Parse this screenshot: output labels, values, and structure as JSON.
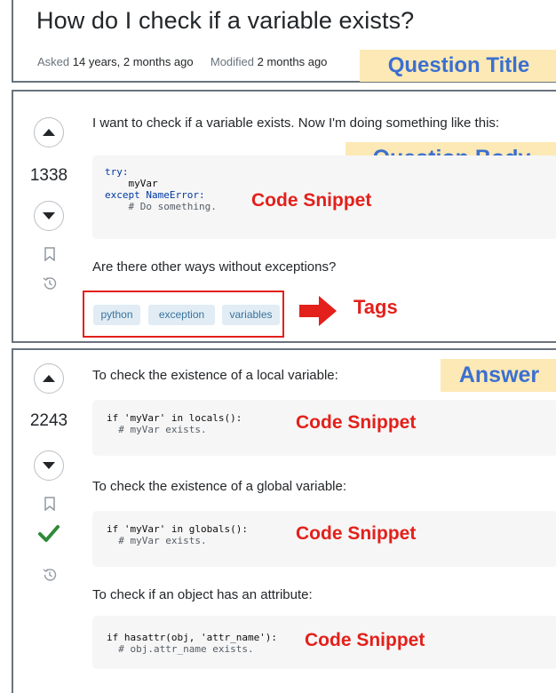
{
  "question": {
    "title": "How do I check if a variable exists?",
    "asked_label": "Asked",
    "asked_value": "14 years, 2 months ago",
    "modified_label": "Modified",
    "modified_value": "2 months ago",
    "score": "1338",
    "body_intro": "I want to check if a variable exists. Now I'm doing something like this:",
    "code_lines": [
      "try:",
      "    myVar",
      "except NameError:",
      "    # Do something."
    ],
    "body_question": "Are there other ways without exceptions?",
    "tags": [
      "python",
      "exception",
      "variables"
    ]
  },
  "answer": {
    "score": "2243",
    "accepted": true,
    "blocks": [
      {
        "text": "To check the existence of a local variable:",
        "code_line1": "if 'myVar' in locals():",
        "code_line2": "  # myVar exists."
      },
      {
        "text": "To check the existence of a global variable:",
        "code_line1": "if 'myVar' in globals():",
        "code_line2": "  # myVar exists."
      },
      {
        "text": "To check if an object has an attribute:",
        "code_line1": "if hasattr(obj, 'attr_name'):",
        "code_line2": "  # obj.attr_name exists."
      }
    ]
  },
  "annotations": {
    "question_title": "Question Title",
    "question_body": "Question Body",
    "code_snippet": "Code Snippet",
    "tags": "Tags",
    "answer": "Answer"
  },
  "icons": {
    "upvote": "caret-up-icon",
    "downvote": "caret-down-icon",
    "bookmark": "bookmark-icon",
    "history": "history-icon",
    "accepted": "checkmark-icon",
    "arrow": "right-arrow-icon"
  },
  "colors": {
    "annotation_bg": "#fde9b5",
    "annotation_text": "#3b6fd1",
    "label_red": "#e3201b",
    "tag_bg": "#e1ecf4",
    "tag_text": "#39739d",
    "accepted_green": "#2f8a3a"
  }
}
